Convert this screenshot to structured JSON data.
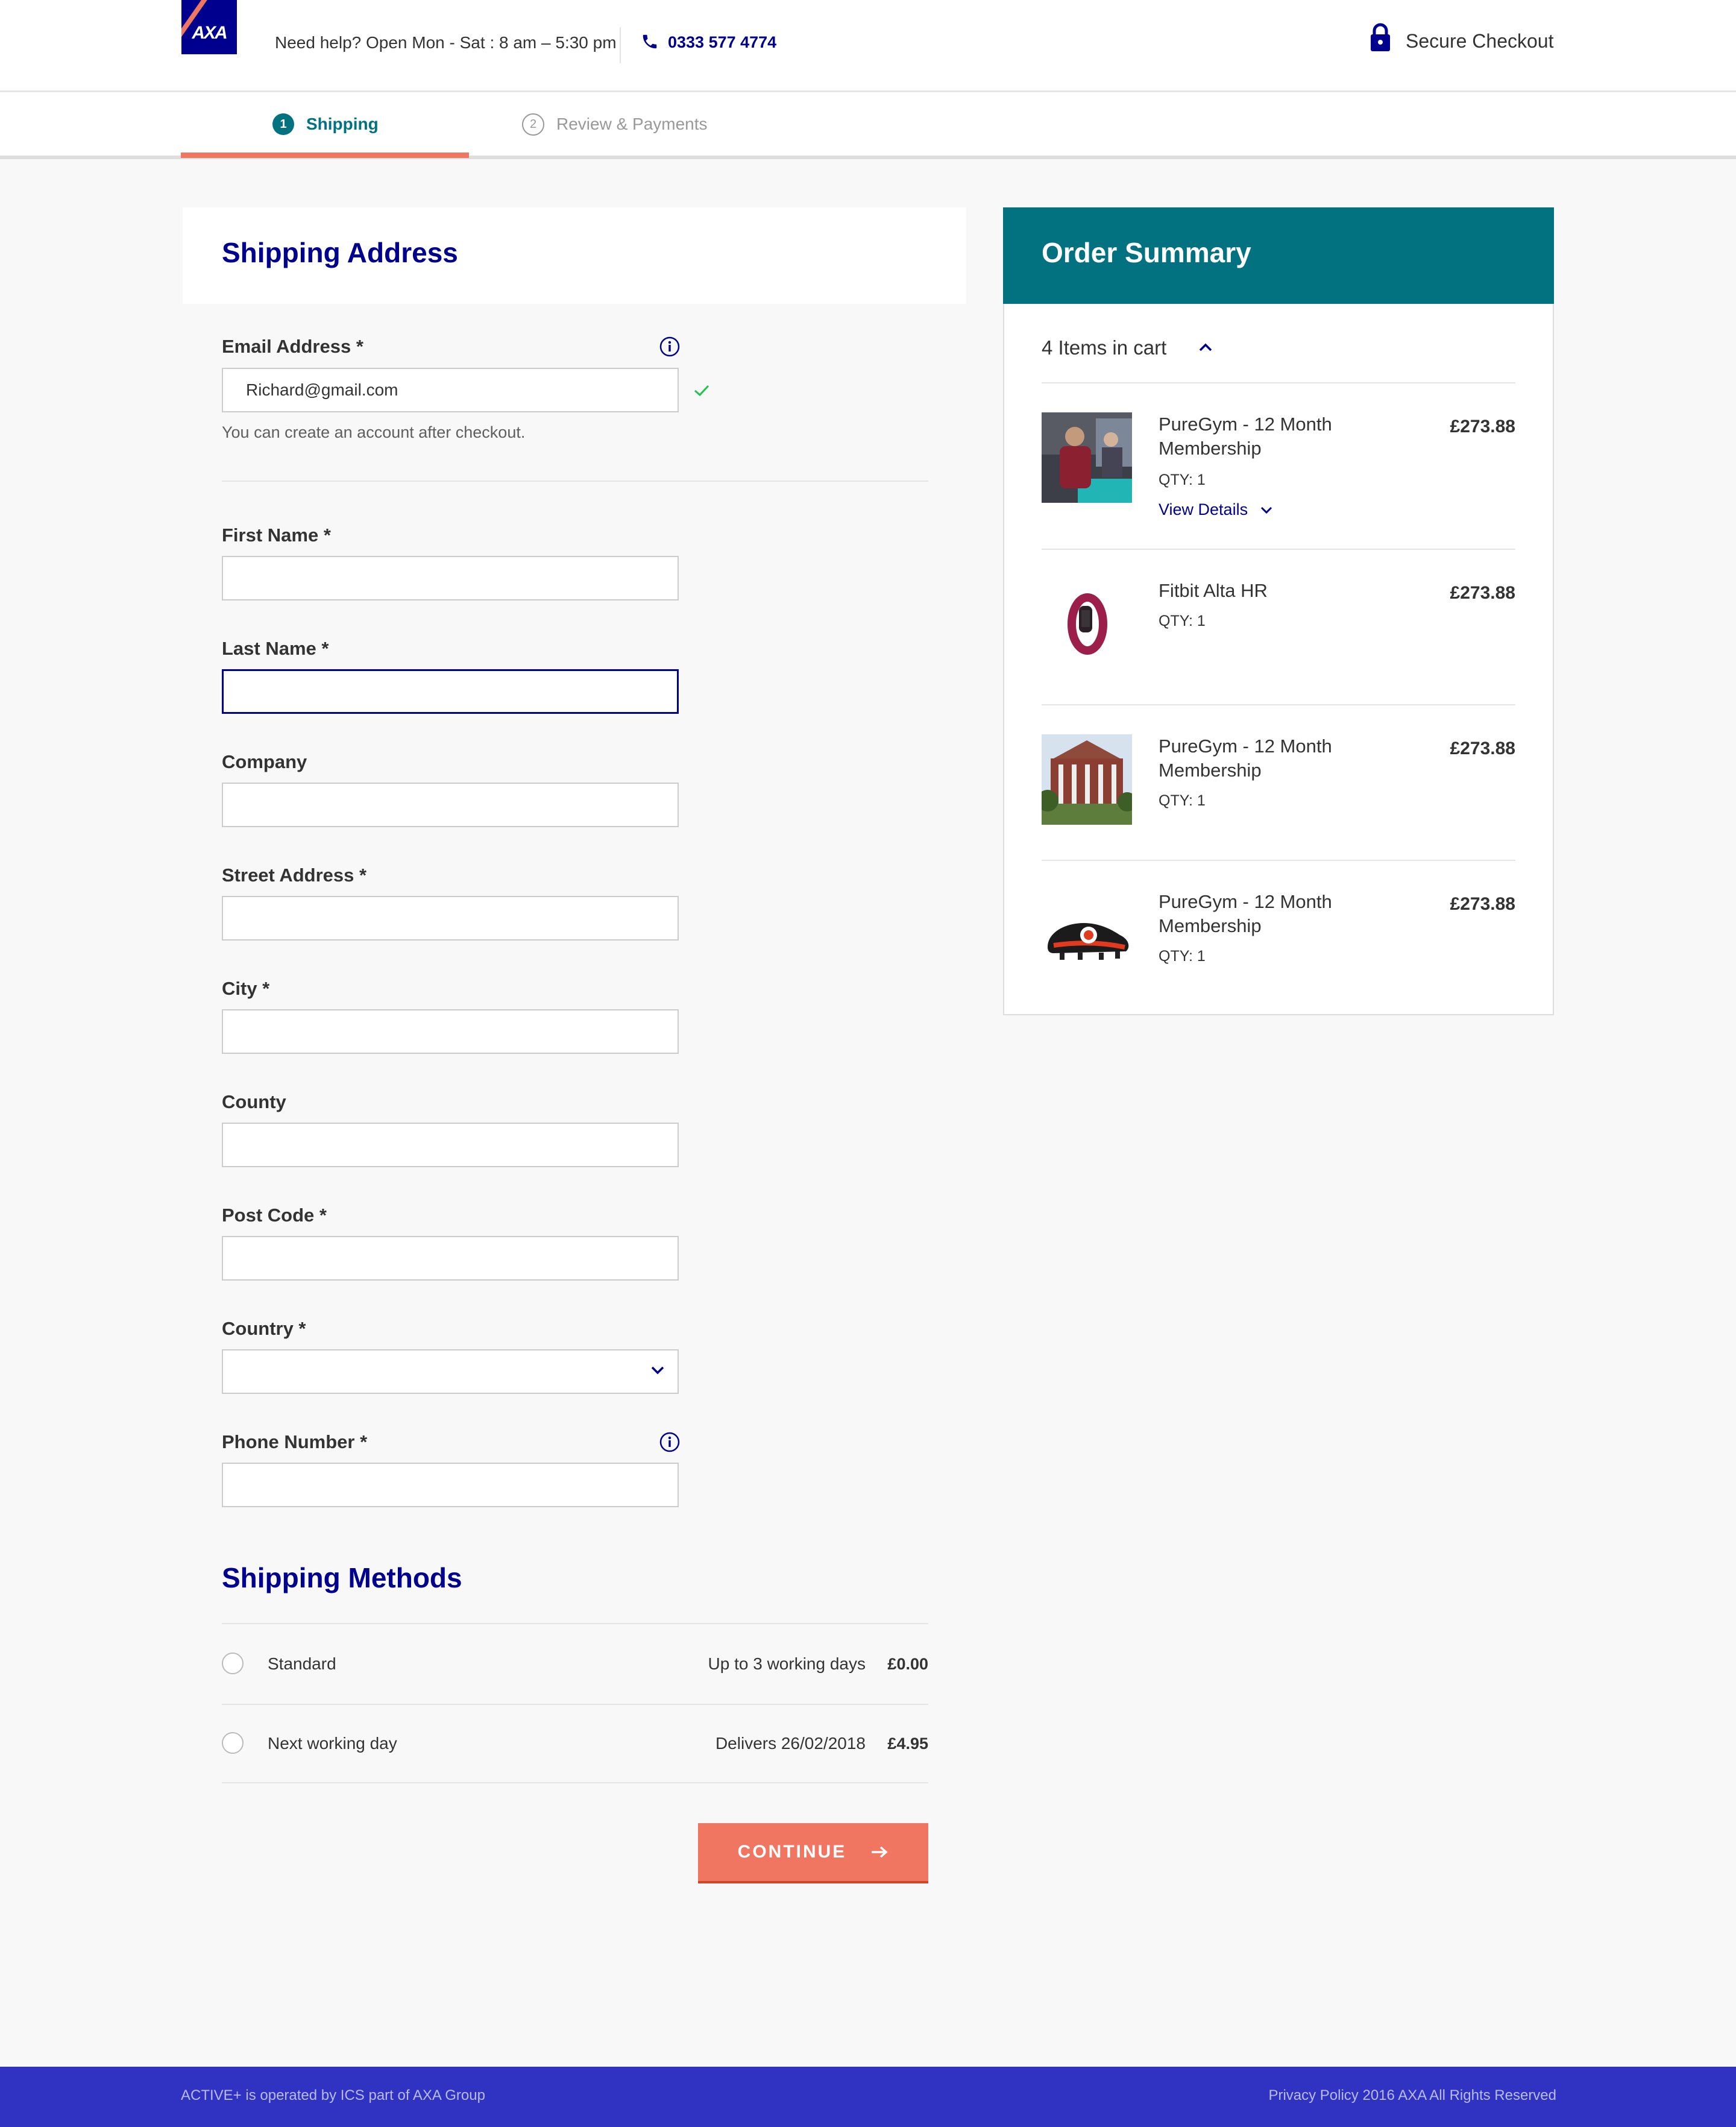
{
  "header": {
    "logo_text": "AXA",
    "help_text": "Need help?  Open Mon - Sat : 8 am – 5:30 pm",
    "phone": "0333 577 4774",
    "secure_label": "Secure Checkout"
  },
  "steps": [
    {
      "number": "1",
      "label": "Shipping",
      "active": true
    },
    {
      "number": "2",
      "label": "Review & Payments",
      "active": false
    }
  ],
  "shipping": {
    "title": "Shipping Address",
    "email": {
      "label": "Email Address *",
      "value": "Richard@gmail.com",
      "hint": "You can create an account after checkout."
    },
    "first_name": {
      "label": "First Name *",
      "value": ""
    },
    "last_name": {
      "label": "Last Name *",
      "value": ""
    },
    "company": {
      "label": "Company",
      "value": ""
    },
    "street": {
      "label": "Street Address *",
      "value": ""
    },
    "city": {
      "label": "City *",
      "value": ""
    },
    "county": {
      "label": "County",
      "value": ""
    },
    "post_code": {
      "label": "Post Code *",
      "value": ""
    },
    "country": {
      "label": "Country *",
      "value": ""
    },
    "phone": {
      "label": "Phone Number *",
      "value": ""
    }
  },
  "methods": {
    "title": "Shipping Methods",
    "items": [
      {
        "name": "Standard",
        "desc": "Up to 3 working days",
        "price": "£0.00"
      },
      {
        "name": "Next working day",
        "desc": "Delivers 26/02/2018",
        "price": "£4.95"
      }
    ],
    "continue_label": "CONTINUE"
  },
  "order_summary": {
    "title": "Order Summary",
    "cart_count": "4 Items in cart",
    "view_details": "View Details",
    "items": [
      {
        "name": "PureGym - 12 Month Membership",
        "qty": "QTY: 1",
        "price": "£273.88"
      },
      {
        "name": "Fitbit Alta HR",
        "qty": "QTY: 1",
        "price": "£273.88"
      },
      {
        "name": "PureGym - 12 Month Membership",
        "qty": "QTY: 1",
        "price": "£273.88"
      },
      {
        "name": "PureGym - 12 Month Membership",
        "qty": "QTY: 1",
        "price": "£273.88"
      }
    ]
  },
  "footer": {
    "left": "ACTIVE+ is operated by ICS part of AXA Group",
    "right": "Privacy Policy 2016 AXA All Rights Reserved"
  },
  "colors": {
    "brand_blue": "#00008f",
    "teal": "#027180",
    "coral": "#f07662",
    "footer_blue": "#3032c1"
  }
}
